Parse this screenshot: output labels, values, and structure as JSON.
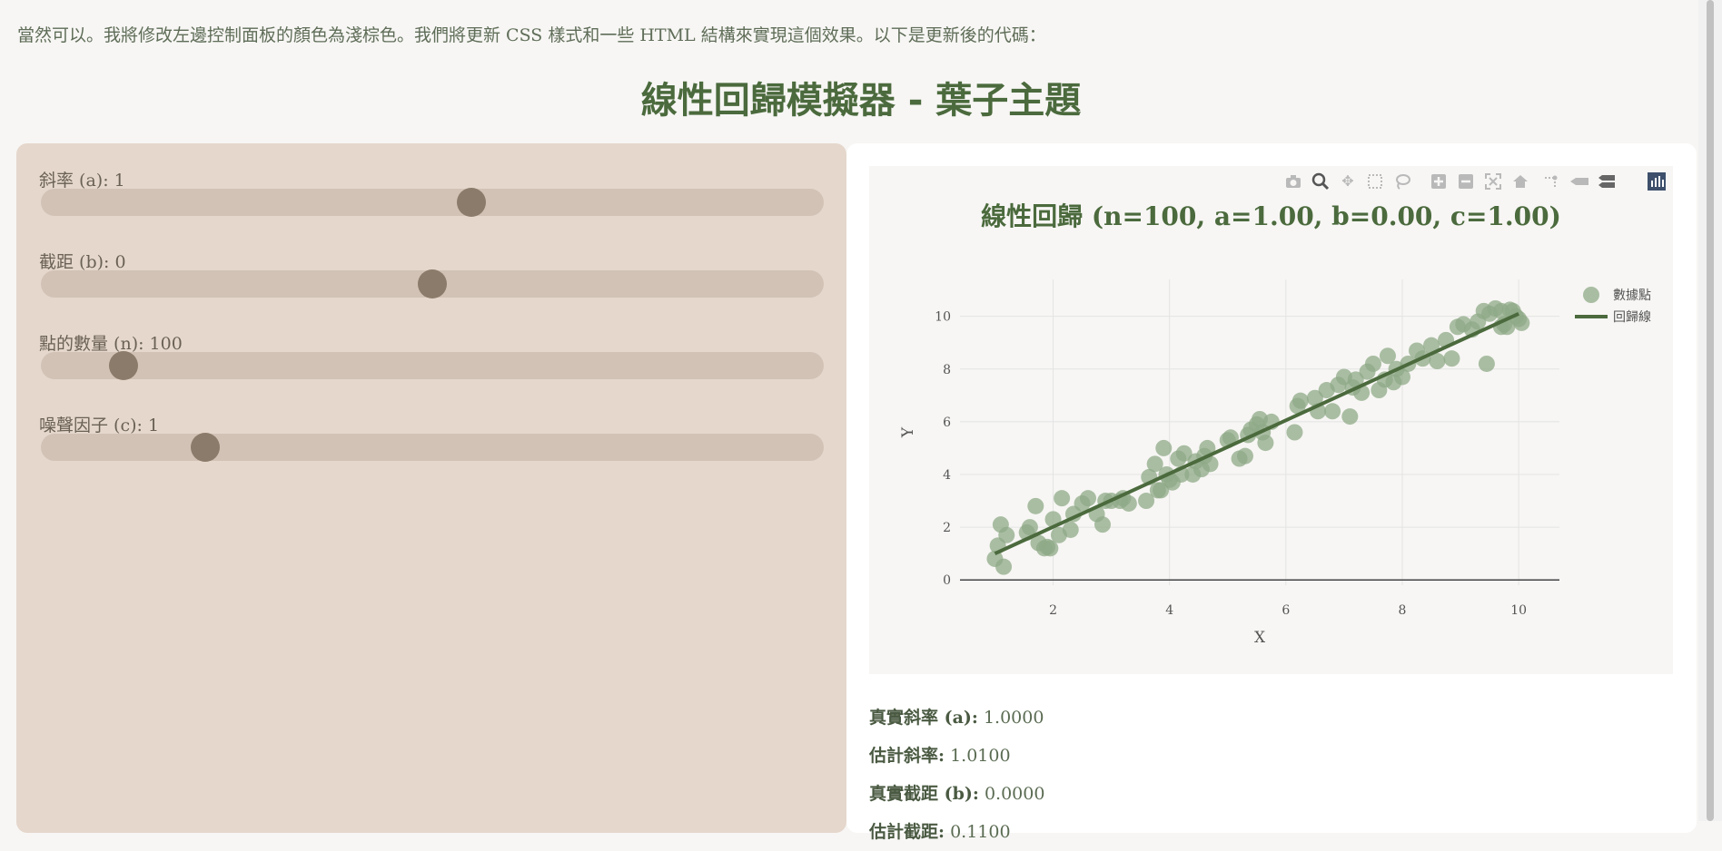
{
  "intro_text": "當然可以。我將修改左邊控制面板的顏色為淺棕色。我們將更新 CSS 樣式和一些 HTML 結構來實現這個效果。以下是更新後的代碼：",
  "page_title": "線性回歸模擬器 - 葉子主題",
  "controls": [
    {
      "label": "斜率 (a): 1",
      "value": 1,
      "min": -5,
      "max": 5,
      "fraction": 0.55
    },
    {
      "label": "截距 (b): 0",
      "value": 0,
      "min": -10,
      "max": 10,
      "fraction": 0.5
    },
    {
      "label": "點的數量 (n): 100",
      "value": 100,
      "min": 10,
      "max": 1000,
      "fraction": 0.105
    },
    {
      "label": "噪聲因子 (c): 1",
      "value": 1,
      "min": 0,
      "max": 5,
      "fraction": 0.21
    }
  ],
  "modebar_icons": [
    "camera-icon",
    "zoom-icon",
    "pan-icon",
    "box-select-icon",
    "lasso-icon",
    "zoom-in-icon",
    "zoom-out-icon",
    "autoscale-icon",
    "home-icon",
    "spike-icon",
    "hover-closest-icon",
    "hover-compare-icon",
    "plotly-logo-icon"
  ],
  "colors": {
    "accent": "#4b6a3d",
    "points": "#8fa987",
    "panel": "#e5d7cc",
    "thumb": "#8b7b6a"
  },
  "chart_data": {
    "type": "scatter",
    "title": "線性回歸 (n=100, a=1.00, b=0.00, c=1.00)",
    "xlabel": "X",
    "ylabel": "Y",
    "xlim": [
      0.4,
      10.7
    ],
    "ylim": [
      -0.2,
      11.4
    ],
    "x_ticks": [
      2,
      4,
      6,
      8,
      10
    ],
    "y_ticks": [
      0,
      2,
      4,
      6,
      8,
      10
    ],
    "grid": true,
    "legend": "top-right",
    "series": [
      {
        "name": "數據點",
        "mode": "markers",
        "x": [
          1.0,
          1.05,
          1.1,
          1.15,
          1.2,
          1.55,
          1.6,
          1.7,
          1.75,
          1.85,
          1.9,
          1.95,
          2.0,
          2.1,
          2.15,
          2.3,
          2.35,
          2.5,
          2.6,
          2.75,
          2.85,
          2.9,
          3.0,
          3.15,
          3.3,
          3.6,
          3.65,
          3.75,
          3.8,
          3.85,
          3.9,
          3.95,
          4.0,
          4.05,
          4.15,
          4.2,
          4.25,
          4.4,
          4.45,
          4.55,
          4.6,
          4.65,
          5.0,
          5.05,
          5.2,
          5.3,
          5.35,
          5.4,
          5.5,
          5.55,
          5.6,
          5.65,
          6.15,
          6.2,
          6.25,
          6.5,
          6.55,
          6.7,
          6.8,
          6.9,
          7.0,
          7.1,
          7.15,
          7.2,
          7.3,
          7.4,
          7.5,
          7.6,
          7.7,
          7.75,
          7.85,
          7.9,
          8.0,
          8.1,
          8.25,
          8.35,
          8.5,
          8.6,
          8.75,
          8.85,
          8.95,
          9.05,
          9.2,
          9.3,
          9.4,
          9.5,
          9.6,
          9.7,
          9.75,
          9.8,
          9.9,
          9.95,
          10.0,
          10.05,
          9.85,
          9.7,
          9.45,
          5.75,
          4.7,
          3.2
        ],
        "y": [
          0.8,
          1.3,
          2.1,
          0.5,
          1.7,
          1.8,
          2.0,
          2.8,
          1.4,
          1.2,
          1.25,
          1.2,
          2.3,
          1.7,
          3.1,
          1.9,
          2.5,
          2.9,
          3.1,
          2.5,
          2.1,
          3.0,
          3.0,
          3.0,
          2.9,
          3.0,
          3.9,
          4.4,
          3.4,
          3.4,
          5.0,
          4.0,
          3.8,
          3.7,
          4.6,
          4.0,
          4.8,
          4.0,
          4.5,
          4.2,
          4.7,
          5.0,
          5.3,
          5.4,
          4.6,
          4.7,
          5.5,
          5.7,
          5.9,
          6.1,
          5.6,
          5.2,
          5.6,
          6.6,
          6.8,
          6.9,
          6.4,
          7.2,
          6.4,
          7.4,
          7.7,
          6.2,
          7.3,
          7.6,
          7.1,
          7.9,
          8.2,
          7.2,
          7.6,
          8.5,
          7.5,
          8.0,
          7.7,
          8.2,
          8.7,
          8.4,
          8.9,
          8.3,
          9.1,
          8.4,
          9.6,
          9.7,
          9.5,
          9.8,
          10.2,
          10.1,
          10.3,
          9.6,
          9.7,
          9.6,
          10.2,
          10.0,
          9.9,
          9.75,
          10.25,
          10.2,
          8.2,
          6.0,
          4.4,
          3.1
        ]
      },
      {
        "name": "回歸線",
        "mode": "lines",
        "x": [
          1.0,
          10.0
        ],
        "y": [
          1.0,
          10.1
        ]
      }
    ]
  },
  "stats": [
    {
      "label": "真實斜率 (a):",
      "value": "1.0000"
    },
    {
      "label": "估計斜率:",
      "value": "1.0100"
    },
    {
      "label": "真實截距 (b):",
      "value": "0.0000"
    },
    {
      "label": "估計截距:",
      "value": "0.1100"
    }
  ]
}
